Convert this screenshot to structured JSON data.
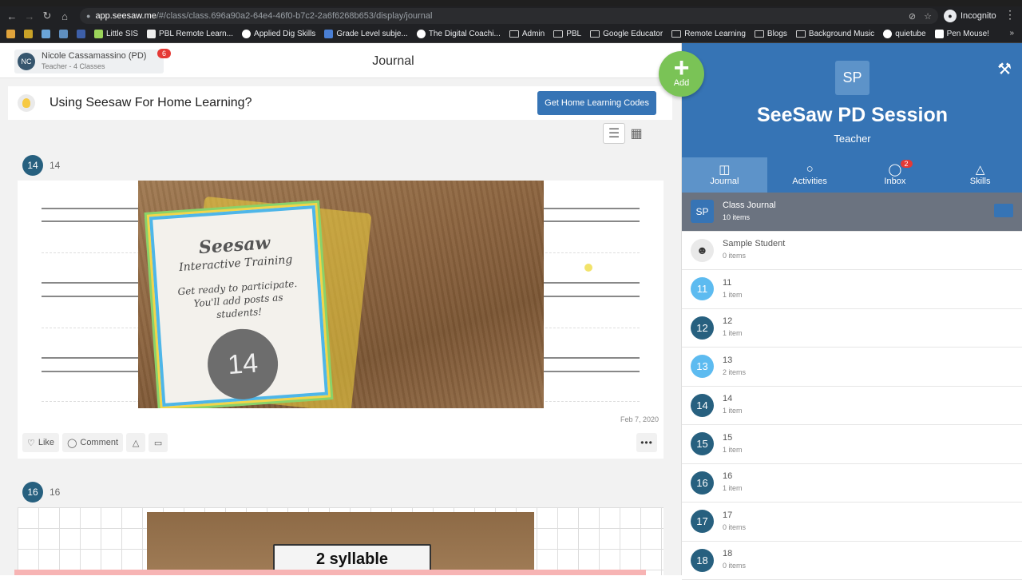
{
  "browser": {
    "url_host": "app.seesaw.me",
    "url_path": "/#/class/class.696a90a2-64e4-46f0-b7c2-2a6f6268b653/display/journal",
    "profile_label": "Incognito",
    "bookmarks": [
      "Little SIS",
      "PBL Remote Learn...",
      "Applied Dig Skills",
      "Grade Level subje...",
      "The Digital Coachi...",
      "Admin",
      "PBL",
      "Google Educator",
      "Remote Learning",
      "Blogs",
      "Background Music",
      "quietube",
      "Pen Mouse!"
    ]
  },
  "header": {
    "user_initials": "NC",
    "user_name": "Nicole Cassamassino (PD)",
    "user_sub": "Teacher - 4 Classes",
    "notification_count": "6",
    "page_title": "Journal",
    "add_label": "Add"
  },
  "banner": {
    "title": "Using Seesaw For Home Learning?",
    "button": "Get Home Learning Codes"
  },
  "posts": [
    {
      "num": "14",
      "label": "14",
      "date": "Feb 7, 2020",
      "card_title": "Seesaw",
      "card_sub": "Interactive Training",
      "card_line1": "Get ready to participate.",
      "card_line2": "You'll add posts as students!",
      "card_num": "14"
    },
    {
      "num": "16",
      "label": "16",
      "card_text": "2 syllable"
    }
  ],
  "actions": {
    "like": "Like",
    "comment": "Comment"
  },
  "class_panel": {
    "initials": "SP",
    "name": "SeeSaw PD Session",
    "role": "Teacher",
    "tabs": [
      {
        "label": "Journal"
      },
      {
        "label": "Activities"
      },
      {
        "label": "Inbox",
        "badge": "2"
      },
      {
        "label": "Skills"
      }
    ],
    "list": [
      {
        "avatar": "SP",
        "name": "Class Journal",
        "count": "10 items"
      },
      {
        "avatar": "",
        "name": "Sample Student",
        "count": "0 items"
      },
      {
        "avatar": "11",
        "name": "11",
        "count": "1 item"
      },
      {
        "avatar": "12",
        "name": "12",
        "count": "1 item"
      },
      {
        "avatar": "13",
        "name": "13",
        "count": "2 items"
      },
      {
        "avatar": "14",
        "name": "14",
        "count": "1 item"
      },
      {
        "avatar": "15",
        "name": "15",
        "count": "1 item"
      },
      {
        "avatar": "16",
        "name": "16",
        "count": "1 item"
      },
      {
        "avatar": "17",
        "name": "17",
        "count": "0 items"
      },
      {
        "avatar": "18",
        "name": "18",
        "count": "0 items"
      }
    ]
  },
  "colors": {
    "brand_blue": "#3674b5",
    "add_green": "#7ac356",
    "badge_red": "#e53935"
  }
}
